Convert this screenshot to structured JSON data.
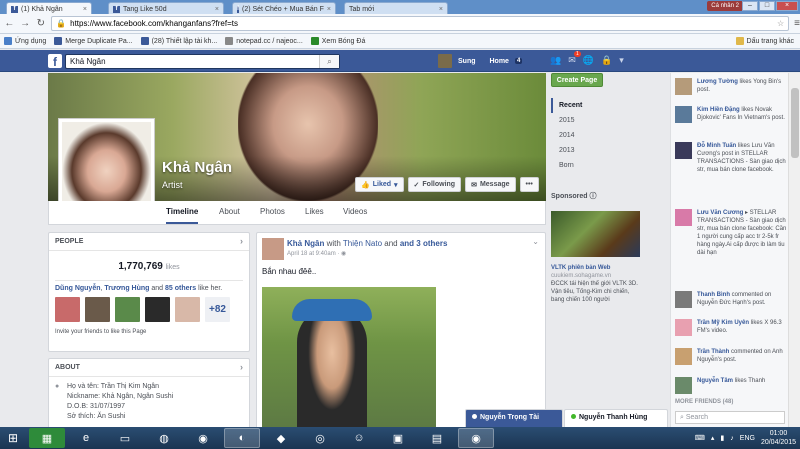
{
  "browser": {
    "tabs": [
      {
        "label": "(1) Khả Ngân",
        "active": true
      },
      {
        "label": "Tang Like 50d",
        "active": false
      },
      {
        "label": "(2) Sét Chéo + Mua Bán F",
        "active": false
      },
      {
        "label": "Tab mới",
        "active": false
      }
    ],
    "user_chip": "Cá nhân 2",
    "url": "https://www.facebook.com/khanganfans?fref=ts",
    "bookmarks": [
      {
        "label": "Ứng dụng",
        "color": "#4a7fc8"
      },
      {
        "label": "Merge Duplicate Pa...",
        "color": "#3b5998"
      },
      {
        "label": "(28) Thiết lập tài kh...",
        "color": "#3b5998"
      },
      {
        "label": "notepad.cc / najeoc...",
        "color": "#888888"
      },
      {
        "label": "Xem Bóng Đá",
        "color": "#2a8a2a"
      }
    ],
    "bookmarks_right": "Dấu trang khác"
  },
  "fb_header": {
    "search_value": "Khả Ngân",
    "user_name": "Sung",
    "home_label": "Home",
    "home_count": "4",
    "notif_badge": "1"
  },
  "page": {
    "name": "Khả Ngân",
    "category": "Artist",
    "liked_label": "Liked",
    "following_label": "Following",
    "message_label": "Message",
    "more_label": "•••",
    "tabs": [
      "Timeline",
      "About",
      "Photos",
      "Likes",
      "Videos"
    ]
  },
  "people": {
    "header": "PEOPLE",
    "likes_count": "1,770,769",
    "likes_label": "likes",
    "friends_line_a": "Dũng Nguyễn",
    "friends_line_b": "Trương Hùng",
    "friends_line_c": "85 others",
    "friends_line_suffix": "like her.",
    "more_count": "+82",
    "invite_text": "Invite your friends to like this Page"
  },
  "about": {
    "header": "ABOUT",
    "lines": [
      "Họ và tên: Trần Thị Kim Ngân",
      "Nickname: Khả Ngân, Ngân Sushi",
      "D.O.B: 31/07/1997",
      "Sở thích: Ăn Sushi"
    ]
  },
  "post": {
    "author": "Khả Ngân",
    "with_text": "with",
    "with_name": "Thiện Nato",
    "and_others": "and 3 others",
    "meta": "April 18 at 9:40am · ",
    "text": "Bắn nhau đêê.."
  },
  "right": {
    "create_page": "Create Page",
    "years": [
      "Recent",
      "2015",
      "2014",
      "2013",
      "Born"
    ],
    "sponsored": "Sponsored",
    "ad_title": "VLTK phiên bản Web",
    "ad_url": "cuukiem.sohagame.vn",
    "ad_desc": "ĐCCK tái hiện thế giới VLTK 3D. Vận tiêu, Tống-Kim chi chiến, bang chiến 100 người"
  },
  "ticker": [
    {
      "name": "Lương Tường",
      "text": " likes Yong Bin's post."
    },
    {
      "name": "Kim Hiền Đặng",
      "text": " likes Novak Djokovic' Fans In Vietnam's post."
    },
    {
      "name": "Đỗ Minh Tuấn",
      "text": " likes Lưu Văn Cương's post in STELLAR TRANSACTIONS - Sàn giao dịch str, mua bán clone facebook."
    },
    {
      "name": "Lưu Văn Cương",
      "text": " ▸ STELLAR TRANSACTIONS - Sàn giao dịch str, mua bán clone facebook: Cần 1 người cung cấp acc tr 2-5k fr hàng ngày.Ai cấp được ib làm tiu dài hạn"
    },
    {
      "name": "Thanh Bình",
      "text": " commented on Nguyễn Đức Hạnh's post."
    },
    {
      "name": "Trần Mỹ Kim Uyên",
      "text": " likes X 96.3 FM's video."
    },
    {
      "name": "Trần Thành",
      "text": " commented on Anh Nguyễn's post."
    },
    {
      "name": "Nguyễn Tâm",
      "text": " likes Thanh"
    }
  ],
  "ticker_more": "MORE FRIENDS (48)",
  "chat_search_placeholder": "Search",
  "chats": [
    {
      "name": "Nguyễn Trọng Tài"
    },
    {
      "name": "Nguyễn Thanh Hùng"
    }
  ],
  "taskbar": {
    "lang": "ENG",
    "time": "01:00",
    "date": "20/04/2015"
  }
}
